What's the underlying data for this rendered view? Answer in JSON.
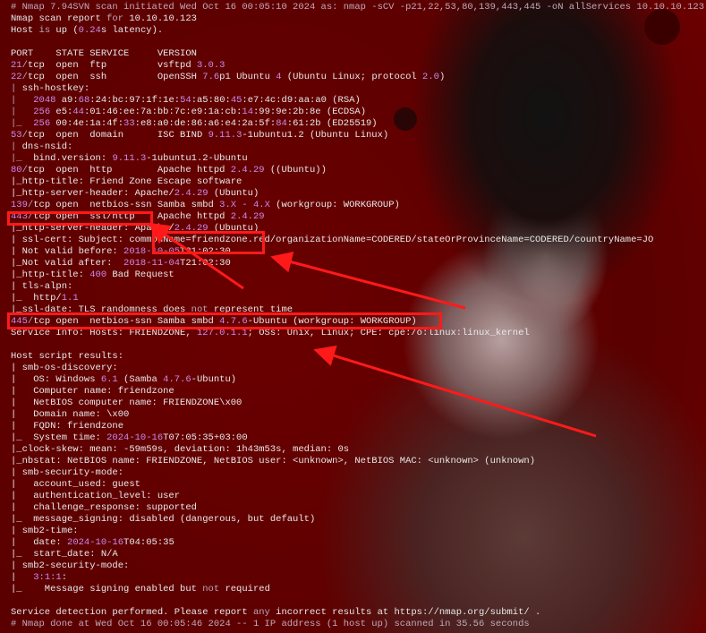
{
  "terminal": {
    "lines": [
      [
        {
          "t": "# Nmap 7.94SVN scan initiated Wed Oct 16 00:05:10 2024 as: nmap -sCV -p21,22,53,80,139,443,445 -oN allServices 10.10.10.123",
          "s": "c"
        }
      ],
      [
        {
          "t": "Nmap scan report "
        },
        {
          "t": "for",
          "s": "m"
        },
        {
          "t": " 10.10.10.123"
        }
      ],
      [
        {
          "t": "Host "
        },
        {
          "t": "is",
          "s": "m"
        },
        {
          "t": " up ("
        },
        {
          "t": "0.24",
          "s": "p"
        },
        {
          "t": "s latency)."
        }
      ],
      [
        {
          "t": ""
        }
      ],
      [
        {
          "t": "PORT    STATE SERVICE     VERSION"
        }
      ],
      [
        {
          "t": "21",
          "s": "p"
        },
        {
          "t": "/",
          "s": "m"
        },
        {
          "t": "tcp  open  ftp         vsftpd "
        },
        {
          "t": "3.0.3",
          "s": "p"
        }
      ],
      [
        {
          "t": "22",
          "s": "p"
        },
        {
          "t": "/",
          "s": "m"
        },
        {
          "t": "tcp  open  ssh         OpenSSH "
        },
        {
          "t": "7.6",
          "s": "p"
        },
        {
          "t": "p1 Ubuntu "
        },
        {
          "t": "4",
          "s": "p"
        },
        {
          "t": " (Ubuntu Linux; protocol "
        },
        {
          "t": "2.0",
          "s": "p"
        },
        {
          "t": ")"
        }
      ],
      [
        {
          "t": "| ",
          "s": "m"
        },
        {
          "t": "ssh-hostkey:"
        }
      ],
      [
        {
          "t": "|   ",
          "s": "m"
        },
        {
          "t": "2048",
          "s": "p"
        },
        {
          "t": " a9:"
        },
        {
          "t": "68",
          "s": "p"
        },
        {
          "t": ":24:bc:97:1f:1e:"
        },
        {
          "t": "54",
          "s": "p"
        },
        {
          "t": ":a5:80:"
        },
        {
          "t": "45",
          "s": "p"
        },
        {
          "t": ":e7:4c:d9:aa:a0 (RSA)"
        }
      ],
      [
        {
          "t": "|   ",
          "s": "m"
        },
        {
          "t": "256",
          "s": "p"
        },
        {
          "t": " e5:"
        },
        {
          "t": "44",
          "s": "p"
        },
        {
          "t": ":01:46:ee:7a:bb:7c:e9:1a:cb:"
        },
        {
          "t": "14",
          "s": "p"
        },
        {
          "t": ":99:9e:2b:8e (ECDSA)"
        }
      ],
      [
        {
          "t": "|_  ",
          "s": "m"
        },
        {
          "t": "256",
          "s": "p"
        },
        {
          "t": " 00:4e:1a:4f:"
        },
        {
          "t": "33",
          "s": "p"
        },
        {
          "t": ":e8:a0:de:86:a6:e4:2a:5f:"
        },
        {
          "t": "84",
          "s": "p"
        },
        {
          "t": ":61:2b (ED25519)"
        }
      ],
      [
        {
          "t": "53",
          "s": "p"
        },
        {
          "t": "/",
          "s": "m"
        },
        {
          "t": "tcp  open  domain      ISC BIND "
        },
        {
          "t": "9.11.3",
          "s": "p"
        },
        {
          "t": "-1ubuntu1.2 (Ubuntu Linux)"
        }
      ],
      [
        {
          "t": "| ",
          "s": "m"
        },
        {
          "t": "dns-nsid:"
        }
      ],
      [
        {
          "t": "|_  ",
          "s": "m"
        },
        {
          "t": "bind.version: "
        },
        {
          "t": "9.11.3",
          "s": "p"
        },
        {
          "t": "-1ubuntu1.2-Ubuntu"
        }
      ],
      [
        {
          "t": "80",
          "s": "p"
        },
        {
          "t": "/",
          "s": "m"
        },
        {
          "t": "tcp  open  http        Apache httpd "
        },
        {
          "t": "2.4.29",
          "s": "p"
        },
        {
          "t": " ((Ubuntu))"
        }
      ],
      [
        {
          "t": "|_http-title: Friend Zone Escape software"
        }
      ],
      [
        {
          "t": "|_http-server-header: Apache/"
        },
        {
          "t": "2.4.29",
          "s": "p"
        },
        {
          "t": " (Ubuntu)"
        }
      ],
      [
        {
          "t": "139",
          "s": "p"
        },
        {
          "t": "/",
          "s": "m"
        },
        {
          "t": "tcp open  netbios-ssn Samba smbd "
        },
        {
          "t": "3.X - 4.X",
          "s": "p"
        },
        {
          "t": " (workgroup: WORKGROUP)"
        }
      ],
      [
        {
          "t": "443",
          "s": "p"
        },
        {
          "t": "/",
          "s": "m"
        },
        {
          "t": "tcp open  ssl/http    Apache httpd "
        },
        {
          "t": "2.4.29",
          "s": "p"
        }
      ],
      [
        {
          "t": "|_http-server-header: Apache/"
        },
        {
          "t": "2.4.29",
          "s": "p"
        },
        {
          "t": " (Ubuntu)"
        }
      ],
      [
        {
          "t": "| ssl-cert: Subject: commonName=friendzone.red/organizationName=CODERED/stateOrProvinceName=CODERED/countryName=JO"
        }
      ],
      [
        {
          "t": "| Not valid before: "
        },
        {
          "t": "2018-10-05",
          "s": "p"
        },
        {
          "t": "T21:02:30"
        }
      ],
      [
        {
          "t": "|_Not valid after:  "
        },
        {
          "t": "2018-11-04",
          "s": "p"
        },
        {
          "t": "T21:02:30"
        }
      ],
      [
        {
          "t": "|_http-title: "
        },
        {
          "t": "400",
          "s": "p"
        },
        {
          "t": " Bad Request"
        }
      ],
      [
        {
          "t": "| tls-alpn:"
        }
      ],
      [
        {
          "t": "|_  http/"
        },
        {
          "t": "1.1",
          "s": "p"
        }
      ],
      [
        {
          "t": "|_ssl-date: TLS randomness does "
        },
        {
          "t": "not",
          "s": "m"
        },
        {
          "t": " represent time"
        }
      ],
      [
        {
          "t": "445",
          "s": "p"
        },
        {
          "t": "/",
          "s": "m"
        },
        {
          "t": "tcp open  netbios-ssn Samba smbd "
        },
        {
          "t": "4.7.6",
          "s": "p"
        },
        {
          "t": "-Ubuntu (workgroup: WORKGROUP)"
        }
      ],
      [
        {
          "t": "Service Info: Hosts: FRIENDZONE, "
        },
        {
          "t": "127.0.1.1",
          "s": "p"
        },
        {
          "t": "; OSs: Unix, Linux; CPE: cpe:/o:linux:linux_kernel"
        }
      ],
      [
        {
          "t": ""
        }
      ],
      [
        {
          "t": "Host script results:"
        }
      ],
      [
        {
          "t": "| smb-os-discovery:"
        }
      ],
      [
        {
          "t": "|   OS: Windows "
        },
        {
          "t": "6.1",
          "s": "p"
        },
        {
          "t": " (Samba "
        },
        {
          "t": "4.7.6",
          "s": "p"
        },
        {
          "t": "-Ubuntu)"
        }
      ],
      [
        {
          "t": "|   Computer name: friendzone"
        }
      ],
      [
        {
          "t": "|   NetBIOS computer name: FRIENDZONE\\x00"
        }
      ],
      [
        {
          "t": "|   Domain name: \\x00"
        }
      ],
      [
        {
          "t": "|   FQDN: friendzone"
        }
      ],
      [
        {
          "t": "|_  System time: "
        },
        {
          "t": "2024-10-16",
          "s": "p"
        },
        {
          "t": "T07:05:35+03:00"
        }
      ],
      [
        {
          "t": "|_clock-skew: mean: -59m59s, deviation: 1h43m53s, median: 0s"
        }
      ],
      [
        {
          "t": "|_nbstat: NetBIOS name: FRIENDZONE, NetBIOS user: <unknown>, NetBIOS MAC: <unknown> (unknown)"
        }
      ],
      [
        {
          "t": "| smb-security-mode:"
        }
      ],
      [
        {
          "t": "|   account_used: guest"
        }
      ],
      [
        {
          "t": "|   authentication_level: user"
        }
      ],
      [
        {
          "t": "|   challenge_response: supported"
        }
      ],
      [
        {
          "t": "|_  message_signing: disabled (dangerous, but default)"
        }
      ],
      [
        {
          "t": "| smb2-time:"
        }
      ],
      [
        {
          "t": "|   date: "
        },
        {
          "t": "2024-10-16",
          "s": "p"
        },
        {
          "t": "T04:05:35"
        }
      ],
      [
        {
          "t": "|_  start_date: N/A"
        }
      ],
      [
        {
          "t": "| smb2-security-mode:"
        }
      ],
      [
        {
          "t": "|   "
        },
        {
          "t": "3:1:1",
          "s": "p"
        },
        {
          "t": ":"
        }
      ],
      [
        {
          "t": "|_    Message signing enabled but "
        },
        {
          "t": "not",
          "s": "m"
        },
        {
          "t": " required"
        }
      ],
      [
        {
          "t": ""
        }
      ],
      [
        {
          "t": "Service detection performed. Please report "
        },
        {
          "t": "any",
          "s": "m"
        },
        {
          "t": " incorrect results at https://nmap.org/submit/ ."
        }
      ],
      [
        {
          "t": "# Nmap done at Wed Oct 16 00:05:46 2024 -- 1 IP address (1 host up) scanned in 35.56 seconds",
          "s": "c"
        }
      ]
    ]
  },
  "colors": {
    "background": "#6e0000",
    "text": "#e8e8e8",
    "keyword": "#b9a7b6",
    "number": "#c78bea",
    "comment": "#c2a8ba",
    "highlight": "#ff1a1a"
  }
}
